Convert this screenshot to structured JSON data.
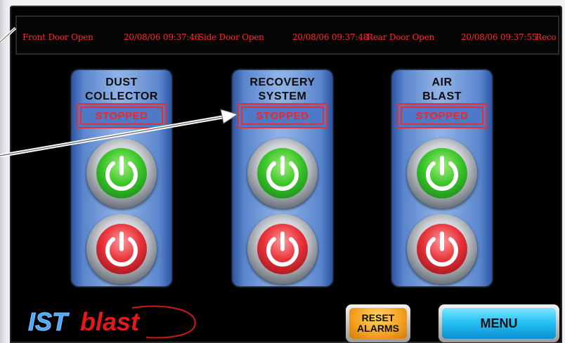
{
  "alarms": [
    {
      "timestamp": "",
      "message": "Front Door Open"
    },
    {
      "timestamp": "20/08/06 09:37:46",
      "message": "Side Door Open"
    },
    {
      "timestamp": "20/08/06 09:37:48",
      "message": "Rear Door Open"
    },
    {
      "timestamp": "20/08/06 09:37:55",
      "message": "Reco"
    }
  ],
  "panels": [
    {
      "title_line1": "DUST",
      "title_line2": "COLLECTOR",
      "status": "STOPPED"
    },
    {
      "title_line1": "RECOVERY",
      "title_line2": "SYSTEM",
      "status": "STOPPED"
    },
    {
      "title_line1": "AIR",
      "title_line2": "BLAST",
      "status": "STOPPED"
    }
  ],
  "logo": {
    "part1": "IST",
    "part2": "blast"
  },
  "buttons": {
    "reset_line1": "RESET",
    "reset_line2": "ALARMS",
    "menu": "MENU"
  },
  "colors": {
    "alarm_text": "#ff2a2a",
    "status_red": "#f0242c",
    "panel_blue": "#6a92d6",
    "start_green": "#3cc42a",
    "stop_red": "#e8323a",
    "menu_cyan": "#28c2f5",
    "reset_orange": "#f4a020"
  },
  "icons": {
    "start": "power-icon",
    "stop": "power-icon"
  }
}
